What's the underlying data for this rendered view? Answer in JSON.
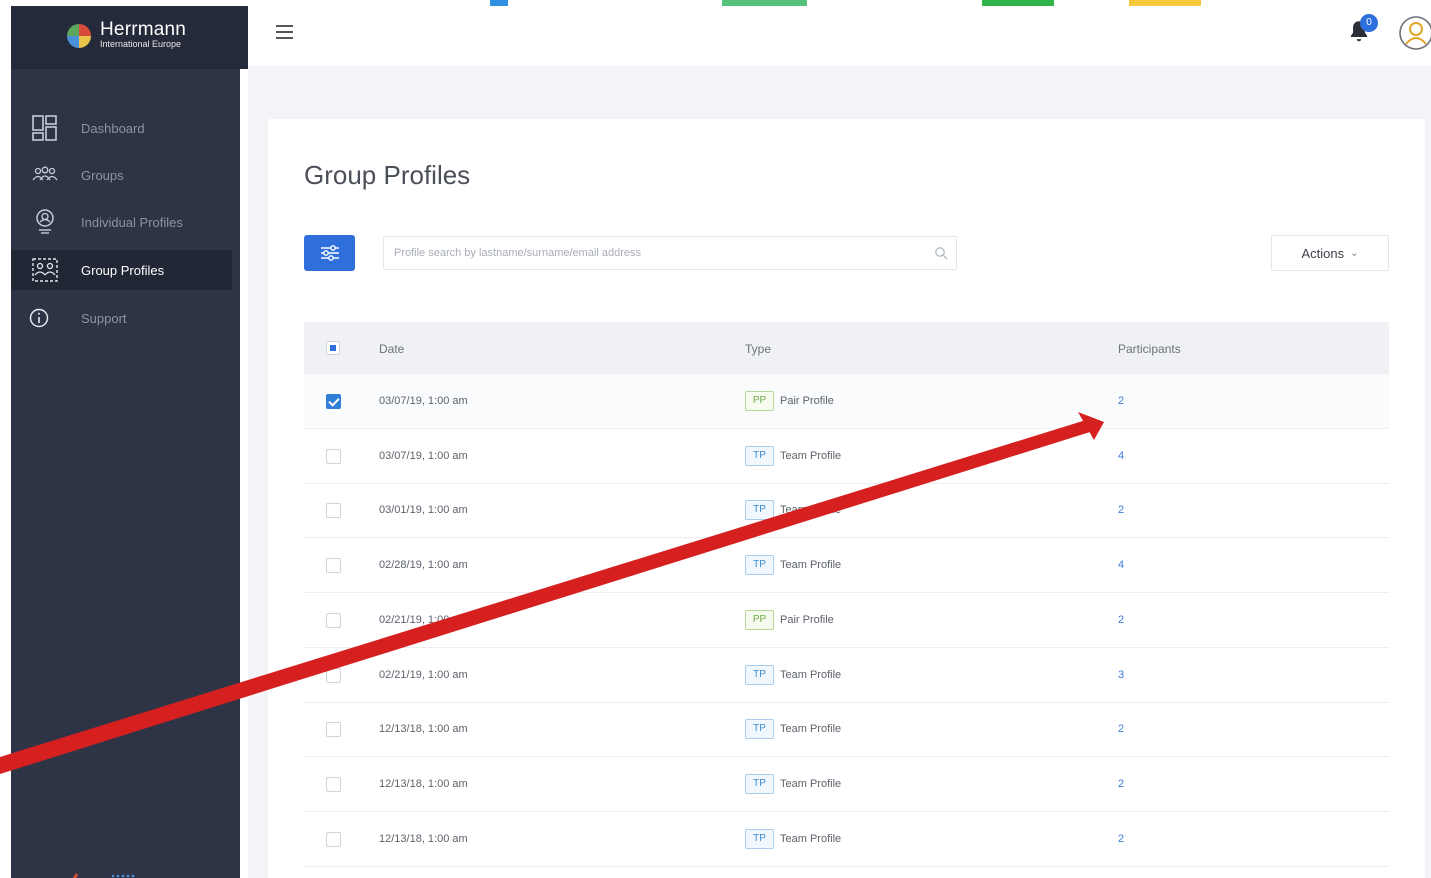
{
  "brand": {
    "name": "Herrmann",
    "subtitle": "International Europe"
  },
  "sidebar": {
    "items": [
      {
        "label": "Dashboard",
        "icon": "dashboard-icon",
        "active": false
      },
      {
        "label": "Groups",
        "icon": "groups-icon",
        "active": false
      },
      {
        "label": "Individual Profiles",
        "icon": "individual-profile-icon",
        "active": false
      },
      {
        "label": "Group Profiles",
        "icon": "group-profiles-icon",
        "active": true
      },
      {
        "label": "Support",
        "icon": "info-icon",
        "active": false
      }
    ]
  },
  "header": {
    "notification_count": "0"
  },
  "main": {
    "title": "Group Profiles",
    "search": {
      "placeholder": "Profile search by lastname/surname/email address",
      "value": ""
    },
    "actions_label": "Actions",
    "table": {
      "columns": [
        "Date",
        "Type",
        "Participants"
      ],
      "rows": [
        {
          "date": "03/07/19, 1:00 am",
          "badge": "PP",
          "type": "Pair Profile",
          "participants": "2",
          "checked": true
        },
        {
          "date": "03/07/19, 1:00 am",
          "badge": "TP",
          "type": "Team Profile",
          "participants": "4",
          "checked": false
        },
        {
          "date": "03/01/19, 1:00 am",
          "badge": "TP",
          "type": "Team Profile",
          "participants": "2",
          "checked": false
        },
        {
          "date": "02/28/19, 1:00 am",
          "badge": "TP",
          "type": "Team Profile",
          "participants": "4",
          "checked": false
        },
        {
          "date": "02/21/19, 1:00 am",
          "badge": "PP",
          "type": "Pair Profile",
          "participants": "2",
          "checked": false
        },
        {
          "date": "02/21/19, 1:00 am",
          "badge": "TP",
          "type": "Team Profile",
          "participants": "3",
          "checked": false
        },
        {
          "date": "12/13/18, 1:00 am",
          "badge": "TP",
          "type": "Team Profile",
          "participants": "2",
          "checked": false
        },
        {
          "date": "12/13/18, 1:00 am",
          "badge": "TP",
          "type": "Team Profile",
          "participants": "2",
          "checked": false
        },
        {
          "date": "12/13/18, 1:00 am",
          "badge": "TP",
          "type": "Team Profile",
          "participants": "2",
          "checked": false
        }
      ]
    }
  },
  "colors": {
    "sidebar": "#2e3446",
    "accent": "#2f6fdc",
    "annotation_arrow": "#d61f1f"
  }
}
